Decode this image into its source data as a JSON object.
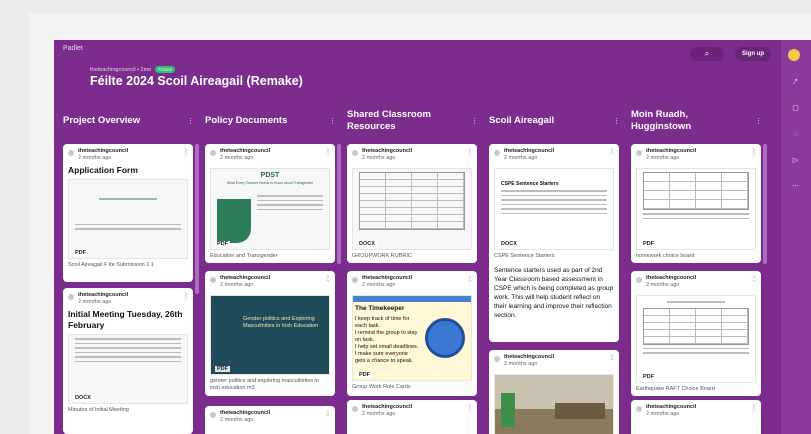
{
  "app": {
    "brand": "Padlet"
  },
  "header": {
    "breadcrumb": "theteachingcouncil • 2mo",
    "badge": "Frozen",
    "title": "Féilte 2024 Scoil Aireagail (Remake)",
    "search_icon": "⌕",
    "signup_label": "Sign up"
  },
  "rail": {
    "icons": [
      "⤤",
      "▢",
      "◌",
      "▷",
      "⋯"
    ]
  },
  "columns": [
    {
      "title": "Project Overview",
      "menu": "⋮"
    },
    {
      "title": "Policy Documents",
      "menu": "⋮"
    },
    {
      "title": "Shared Classroom Resources",
      "menu": "⋮"
    },
    {
      "title": "Scoil Aireagail",
      "menu": "⋮"
    },
    {
      "title": "Moin Ruadh, Hugginstown",
      "menu": "⋮"
    }
  ],
  "cards": {
    "c1": {
      "author": "theteachingcouncil",
      "ago": "2 months ago",
      "heading": "Application Form",
      "ftype": "PDF",
      "caption": "Scoil Aireagail F ite Submission 1 1"
    },
    "c2": {
      "author": "theteachingcouncil",
      "ago": "2 months ago",
      "heading": "Initial Meeting Tuesday, 26th February",
      "ftype": "DOCX",
      "caption": "Minutes of Initial Meeting"
    },
    "c3": {
      "author": "theteachingcouncil",
      "ago": "2 months ago",
      "thumb_title": "PDST",
      "thumb_sub": "What Every Teacher Needs to Know about Transgender",
      "ftype": "PDF",
      "caption": "Education and Transgender"
    },
    "c4": {
      "author": "theteachingcouncil",
      "ago": "2 months ago",
      "thumb_title": "Gender politics and Exploring Masculinities in Irish Education",
      "ftype": "PDF",
      "caption": "gender politics and exploring masculinities in irish education m3"
    },
    "c5": {
      "author": "theteachingcouncil",
      "ago": "2 months ago"
    },
    "c6": {
      "author": "theteachingcouncil",
      "ago": "2 months ago",
      "ftype": "DOCX",
      "caption": "GROUPWORK RUBRIC"
    },
    "c7": {
      "author": "theteachingcouncil",
      "ago": "2 months ago",
      "thumb_title": "The Timekeeper",
      "bullets": [
        "I keep track of time for each task.",
        "I remind the group to stay on task.",
        "I help set small deadlines.",
        "I make sure everyone gets a chance to speak."
      ],
      "ftype": "PDF",
      "caption": "Group Work Role Cards"
    },
    "c8": {
      "author": "theteachingcouncil",
      "ago": "2 months ago"
    },
    "c9": {
      "author": "theteachingcouncil",
      "ago": "2 months ago",
      "thumb_title": "CSPE Sentence Starters",
      "ftype": "DOCX",
      "caption": "CSPE Sentence Starters",
      "body": "Sentence starters used as part of 2nd Year Classroom based assessment in CSPE which is being completed as group work. This will help student reflect on their learning and improve their reflection section."
    },
    "c10": {
      "author": "theteachingcouncil",
      "ago": "2 months ago"
    },
    "c11": {
      "author": "theteachingcouncil",
      "ago": "2 months ago",
      "ftype": "PDF",
      "caption": "homework choice board"
    },
    "c12": {
      "author": "theteachingcouncil",
      "ago": "2 months ago",
      "ftype": "PDF",
      "caption": "Earthquake RAFT Choice Board"
    },
    "c13": {
      "author": "theteachingcouncil",
      "ago": "2 months ago"
    }
  }
}
